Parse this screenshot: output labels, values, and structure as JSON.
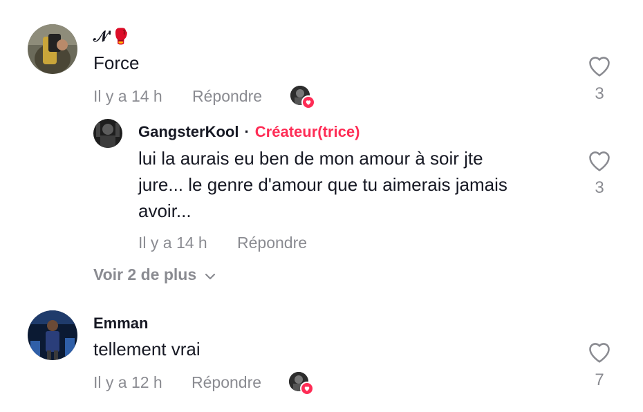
{
  "comments": [
    {
      "username": "𝒩'🥊",
      "text": "Force",
      "time": "Il y a 14 h",
      "reply_label": "Répondre",
      "likes": "3",
      "liked_by_creator": true,
      "replies": [
        {
          "username": "GangsterKool",
          "separator": "·",
          "creator_label": "Créateur(trice)",
          "text_lines": [
            "lui la aurais eu ben de mon amour à soir jte",
            "jure... le genre d'amour que tu aimerais jamais",
            "avoir..."
          ],
          "time": "Il y a 14 h",
          "reply_label": "Répondre",
          "likes": "3"
        }
      ],
      "view_more_label": "Voir 2 de plus"
    },
    {
      "username": "Emman",
      "text": "tellement vrai",
      "time": "Il y a 12 h",
      "reply_label": "Répondre",
      "likes": "7",
      "liked_by_creator": true
    }
  ],
  "colors": {
    "accent": "#fe2c55",
    "meta_gray": "#8a8b91",
    "text": "#161823"
  }
}
